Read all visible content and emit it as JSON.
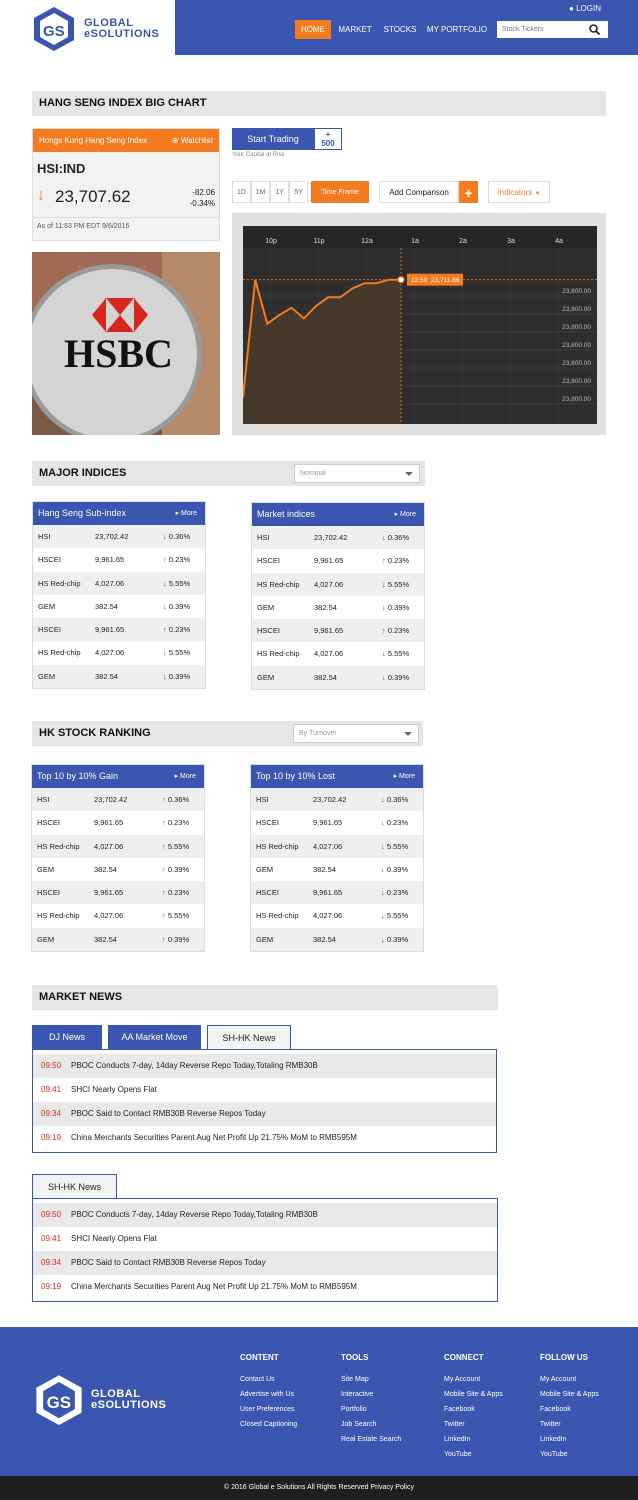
{
  "header": {
    "logo_line1": "GLOBAL",
    "logo_line2": "eSOLUTIONS",
    "login": "LOGIN",
    "nav": [
      "HOME",
      "MARKET",
      "STOCKS",
      "MY PORTFOLIO"
    ],
    "search_placeholder": "Stock Tickers",
    "accent": "#f47b20",
    "brand": "#3a56b0"
  },
  "big_chart": {
    "section_title": "HANG SENG INDEX BIG CHART",
    "card": {
      "name": "Hongs Kong Hang Seng Index",
      "watchlist": "Watchlist",
      "ticker": "HSI:IND",
      "price": "23,707.62",
      "change": "-82.06",
      "change_pct": "-0.34%",
      "as_of": "As of 11:53 PM EDT 9/6/2016"
    },
    "start_trading": "Start Trading",
    "plus_label": "+",
    "plus_value": "500",
    "risk_note": "Your Capital at Risk",
    "timeframes": [
      "1D",
      "1M",
      "1Y",
      "5Y"
    ],
    "time_frame": "Time Frame",
    "add_comparison": "Add Comparison",
    "add_plus": "+",
    "indicators": "Indicators",
    "image_text": "HSBC"
  },
  "chart_data": {
    "type": "area",
    "x_ticks": [
      "10p",
      "11p",
      "12a",
      "1a",
      "2a",
      "3a",
      "4a"
    ],
    "y_ticks": [
      "23,800.00",
      "23,800.00",
      "23,800.00",
      "23,800.00",
      "23,800.00",
      "23,800.00",
      "23,800.00"
    ],
    "tooltip_time": "12.50",
    "tooltip_value": "23,711.86",
    "series": [
      {
        "values": [
          0.15,
          0.82,
          0.57,
          0.62,
          0.66,
          0.6,
          0.67,
          0.72,
          0.72,
          0.77,
          0.8,
          0.8,
          0.82,
          0.82
        ]
      }
    ]
  },
  "major_indices": {
    "title": "MAJOR INDICES",
    "select": "Nominal",
    "tables": [
      {
        "title": "Hang Seng Sub-index",
        "more": "More",
        "rows": [
          {
            "name": "HSI",
            "value": "23,702.42",
            "chg": "0.36%",
            "dir": "down"
          },
          {
            "name": "HSCEI",
            "value": "9,961.65",
            "chg": "0.23%",
            "dir": "up"
          },
          {
            "name": "HS Red-chip",
            "value": "4,027.06",
            "chg": "5.55%",
            "dir": "down"
          },
          {
            "name": "GEM",
            "value": "382.54",
            "chg": "0.39%",
            "dir": "down"
          },
          {
            "name": "HSCEI",
            "value": "9,961.65",
            "chg": "0.23%",
            "dir": "up"
          },
          {
            "name": "HS Red-chip",
            "value": "4,027.06",
            "chg": "5.55%",
            "dir": "down"
          },
          {
            "name": "GEM",
            "value": "382.54",
            "chg": "0.39%",
            "dir": "down"
          }
        ]
      },
      {
        "title": "Market indices",
        "more": "More",
        "rows": [
          {
            "name": "HSI",
            "value": "23,702.42",
            "chg": "0.36%",
            "dir": "down"
          },
          {
            "name": "HSCEI",
            "value": "9,961.65",
            "chg": "0.23%",
            "dir": "up"
          },
          {
            "name": "HS Red-chip",
            "value": "4,027.06",
            "chg": "5.55%",
            "dir": "down"
          },
          {
            "name": "GEM",
            "value": "382.54",
            "chg": "0.39%",
            "dir": "down"
          },
          {
            "name": "HSCEI",
            "value": "9,961.65",
            "chg": "0.23%",
            "dir": "up"
          },
          {
            "name": "HS Red-chip",
            "value": "4,027.06",
            "chg": "5.55%",
            "dir": "down"
          },
          {
            "name": "GEM",
            "value": "382.54",
            "chg": "0.39%",
            "dir": "down"
          }
        ]
      }
    ]
  },
  "ranking": {
    "title": "HK STOCK RANKING",
    "select": "By Turnover",
    "tables": [
      {
        "title": "Top 10 by 10% Gain",
        "more": "More",
        "rows": [
          {
            "name": "HSI",
            "value": "23,702.42",
            "chg": "0.36%",
            "dir": "up"
          },
          {
            "name": "HSCEI",
            "value": "9,961.65",
            "chg": "0.23%",
            "dir": "up"
          },
          {
            "name": "HS Red-chip",
            "value": "4,027.06",
            "chg": "5.55%",
            "dir": "up"
          },
          {
            "name": "GEM",
            "value": "382.54",
            "chg": "0.39%",
            "dir": "up"
          },
          {
            "name": "HSCEI",
            "value": "9,961.65",
            "chg": "0.23%",
            "dir": "up"
          },
          {
            "name": "HS Red-chip",
            "value": "4,027.06",
            "chg": "5.55%",
            "dir": "up"
          },
          {
            "name": "GEM",
            "value": "382.54",
            "chg": "0.39%",
            "dir": "up"
          }
        ]
      },
      {
        "title": "Top 10 by 10% Lost",
        "more": "More",
        "rows": [
          {
            "name": "HSI",
            "value": "23,702.42",
            "chg": "0.36%",
            "dir": "down"
          },
          {
            "name": "HSCEI",
            "value": "9,961.65",
            "chg": "0.23%",
            "dir": "down"
          },
          {
            "name": "HS Red-chip",
            "value": "4,027.06",
            "chg": "5.55%",
            "dir": "down"
          },
          {
            "name": "GEM",
            "value": "382.54",
            "chg": "0.39%",
            "dir": "down"
          },
          {
            "name": "HSCEI",
            "value": "9,961.65",
            "chg": "0.23%",
            "dir": "down"
          },
          {
            "name": "HS Red-chip",
            "value": "4,027.06",
            "chg": "5.55%",
            "dir": "down"
          },
          {
            "name": "GEM",
            "value": "382.54",
            "chg": "0.39%",
            "dir": "down"
          }
        ]
      }
    ]
  },
  "news": {
    "title": "MARKET NEWS",
    "tabs": [
      "DJ News",
      "AA Market Move",
      "SH-HK News"
    ],
    "items": [
      {
        "time": "09:50",
        "headline": "PBOC Conducts 7-day, 14day Reverse Repo Today,Totaling RMB30B"
      },
      {
        "time": "09:41",
        "headline": "SHCI Nearly Opens Flat"
      },
      {
        "time": "09:34",
        "headline": "PBOC Said to Contact RMB30B Reverse Repos Today"
      },
      {
        "time": "09:19",
        "headline": "China Merchants Securities Parent Aug Net Profit Up 21.75% MoM to RMB595M"
      }
    ],
    "second_tab": "SH-HK News"
  },
  "footer": {
    "columns": [
      {
        "title": "CONTENT",
        "links": [
          "Contact Us",
          "Advertise with Us",
          "User Preferences",
          "Closed Captioning"
        ]
      },
      {
        "title": "TOOLS",
        "links": [
          "Site Map",
          "Interactive",
          "Portfolio",
          "Job Search",
          "Real Estate Search"
        ]
      },
      {
        "title": "CONNECT",
        "links": [
          "My Account",
          "Mobile Site & Apps",
          "Facebook",
          "Twitter",
          "LinkedIn",
          "YouTube"
        ]
      },
      {
        "title": "FOLLOW US",
        "links": [
          "My Account",
          "Mobile Site & Apps",
          "Facebook",
          "Twitter",
          "LinkedIn",
          "YouTube"
        ]
      }
    ],
    "copyright": "© 2016 Global e Solutions All Rights Reserved Privacy Policy"
  }
}
